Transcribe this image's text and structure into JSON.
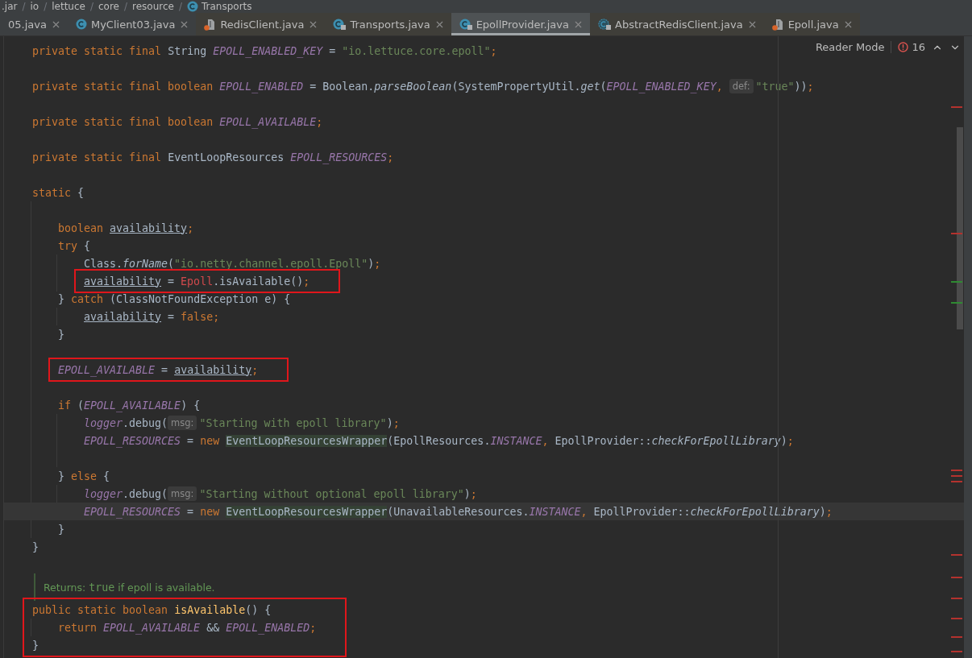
{
  "breadcrumb_separator": "/",
  "breadcrumb": [
    {
      "label": ".jar"
    },
    {
      "label": "io"
    },
    {
      "label": "lettuce"
    },
    {
      "label": "core"
    },
    {
      "label": "resource"
    },
    {
      "label": "Transports",
      "kind": "class"
    }
  ],
  "tabs": [
    {
      "label": "05.java",
      "selected": false
    },
    {
      "label": "MyClient03.java",
      "kind": "class",
      "selected": false
    },
    {
      "label": "RedisClient.java",
      "kind": "library",
      "selected": false
    },
    {
      "label": "Transports.java",
      "kind": "locked-class",
      "selected": false
    },
    {
      "label": "EpollProvider.java",
      "kind": "locked-class",
      "selected": true
    },
    {
      "label": "AbstractRedisClient.java",
      "kind": "abstract",
      "selected": false
    },
    {
      "label": "Epoll.java",
      "kind": "library",
      "selected": false
    }
  ],
  "reader_mode": {
    "label": "Reader Mode",
    "error_count": "16"
  },
  "lines": [
    {
      "kind": "code",
      "boxed": false,
      "tokens": [
        {
          "kind": "kw",
          "text": "private static final "
        },
        {
          "kind": "plain",
          "text": "String "
        },
        {
          "kind": "const",
          "text": "EPOLL_ENABLED_KEY"
        },
        {
          "kind": "plain",
          "text": " = "
        },
        {
          "kind": "str",
          "text": "\"io.lettuce.core.epoll\""
        },
        {
          "kind": "kw",
          "text": ";"
        }
      ]
    },
    {
      "kind": "blank"
    },
    {
      "kind": "code",
      "boxed": false,
      "tokens": [
        {
          "kind": "kw",
          "text": "private static final boolean "
        },
        {
          "kind": "const",
          "text": "EPOLL_ENABLED"
        },
        {
          "kind": "plain",
          "text": " = Boolean."
        },
        {
          "kind": "method",
          "text": "parseBoolean"
        },
        {
          "kind": "plain",
          "text": "(SystemPropertyUtil."
        },
        {
          "kind": "method",
          "text": "get"
        },
        {
          "kind": "plain",
          "text": "("
        },
        {
          "kind": "const",
          "text": "EPOLL_ENABLED_KEY"
        },
        {
          "kind": "kw",
          "text": ", "
        },
        {
          "kind": "hint",
          "text": "def:"
        },
        {
          "kind": "str",
          "text": "\"true\""
        },
        {
          "kind": "plain",
          "text": "))"
        },
        {
          "kind": "kw",
          "text": ";"
        }
      ]
    },
    {
      "kind": "blank"
    },
    {
      "kind": "code",
      "boxed": false,
      "tokens": [
        {
          "kind": "kw",
          "text": "private static final boolean "
        },
        {
          "kind": "const",
          "text": "EPOLL_AVAILABLE"
        },
        {
          "kind": "kw",
          "text": ";"
        }
      ]
    },
    {
      "kind": "blank"
    },
    {
      "kind": "code",
      "boxed": false,
      "tokens": [
        {
          "kind": "kw",
          "text": "private static final "
        },
        {
          "kind": "plain",
          "text": "EventLoopResources "
        },
        {
          "kind": "const",
          "text": "EPOLL_RESOURCES"
        },
        {
          "kind": "kw",
          "text": ";"
        }
      ]
    },
    {
      "kind": "blank"
    },
    {
      "kind": "block",
      "boxed": false,
      "head": [
        {
          "kind": "kw",
          "text": "static "
        },
        {
          "kind": "plain",
          "text": "{"
        }
      ],
      "close": [
        {
          "kind": "plain",
          "text": "}"
        }
      ],
      "children": [
        {
          "kind": "blank"
        },
        {
          "kind": "code",
          "boxed": false,
          "tokens": [
            {
              "kind": "kw",
              "text": "boolean "
            },
            {
              "kind": "var",
              "text": "availability"
            },
            {
              "kind": "kw",
              "text": ";"
            }
          ]
        },
        {
          "kind": "block",
          "boxed": false,
          "head": [
            {
              "kind": "kw",
              "text": "try "
            },
            {
              "kind": "plain",
              "text": "{"
            }
          ],
          "children": [
            {
              "kind": "code",
              "boxed": false,
              "tokens": [
                {
                  "kind": "plain",
                  "text": "Class."
                },
                {
                  "kind": "method",
                  "text": "forName"
                },
                {
                  "kind": "plain",
                  "text": "("
                },
                {
                  "kind": "str",
                  "text": "\"io.netty.channel.epoll.Epoll\""
                },
                {
                  "kind": "plain",
                  "text": ")"
                },
                {
                  "kind": "kw",
                  "text": ";"
                }
              ]
            },
            {
              "kind": "code",
              "boxed": true,
              "tokens": [
                {
                  "kind": "var",
                  "text": "availability"
                },
                {
                  "kind": "plain",
                  "text": " = "
                },
                {
                  "kind": "error",
                  "text": "Epoll"
                },
                {
                  "kind": "plain",
                  "text": ".isAvailable()"
                },
                {
                  "kind": "kw",
                  "text": ";"
                }
              ]
            }
          ]
        },
        {
          "kind": "block",
          "boxed": false,
          "head": [
            {
              "kind": "plain",
              "text": "} "
            },
            {
              "kind": "kw",
              "text": "catch "
            },
            {
              "kind": "plain",
              "text": "(ClassNotFoundException e) {"
            }
          ],
          "close": [
            {
              "kind": "plain",
              "text": "}"
            }
          ],
          "children": [
            {
              "kind": "code",
              "boxed": false,
              "tokens": [
                {
                  "kind": "var",
                  "text": "availability"
                },
                {
                  "kind": "plain",
                  "text": " = "
                },
                {
                  "kind": "kw",
                  "text": "false;"
                }
              ]
            }
          ]
        },
        {
          "kind": "blank"
        },
        {
          "kind": "code",
          "boxed": true,
          "tokens": [
            {
              "kind": "const",
              "text": "EPOLL_AVAILABLE"
            },
            {
              "kind": "plain",
              "text": " = "
            },
            {
              "kind": "var",
              "text": "availability"
            },
            {
              "kind": "kw",
              "text": ";"
            }
          ]
        },
        {
          "kind": "blank"
        },
        {
          "kind": "block",
          "boxed": false,
          "head": [
            {
              "kind": "kw",
              "text": "if "
            },
            {
              "kind": "plain",
              "text": "("
            },
            {
              "kind": "const",
              "text": "EPOLL_AVAILABLE"
            },
            {
              "kind": "plain",
              "text": ") {"
            }
          ],
          "children": [
            {
              "kind": "code",
              "boxed": false,
              "tokens": [
                {
                  "kind": "const",
                  "text": "logger"
                },
                {
                  "kind": "plain",
                  "text": ".debug("
                },
                {
                  "kind": "hint",
                  "text": "msg:"
                },
                {
                  "kind": "str",
                  "text": "\"Starting with epoll library\""
                },
                {
                  "kind": "plain",
                  "text": ")"
                },
                {
                  "kind": "kw",
                  "text": ";"
                }
              ]
            },
            {
              "kind": "code",
              "boxed": false,
              "tokens": [
                {
                  "kind": "const",
                  "text": "EPOLL_RESOURCES"
                },
                {
                  "kind": "plain",
                  "text": " = "
                },
                {
                  "kind": "kw",
                  "text": "new "
                },
                {
                  "kind": "wrapper",
                  "text": "EventLoopResourcesWrapper"
                },
                {
                  "kind": "plain",
                  "text": "(EpollResources."
                },
                {
                  "kind": "const",
                  "text": "INSTANCE"
                },
                {
                  "kind": "kw",
                  "text": ", "
                },
                {
                  "kind": "plain",
                  "text": "EpollProvider::"
                },
                {
                  "kind": "method",
                  "text": "checkForEpollLibrary"
                },
                {
                  "kind": "plain",
                  "text": ")"
                },
                {
                  "kind": "kw",
                  "text": ";"
                }
              ]
            },
            {
              "kind": "blank"
            }
          ]
        },
        {
          "kind": "block",
          "boxed": false,
          "head": [
            {
              "kind": "plain",
              "text": "} "
            },
            {
              "kind": "kw",
              "text": "else "
            },
            {
              "kind": "plain",
              "text": "{"
            }
          ],
          "close": [
            {
              "kind": "plain",
              "text": "}"
            }
          ],
          "children": [
            {
              "kind": "code",
              "boxed": false,
              "tokens": [
                {
                  "kind": "const",
                  "text": "logger"
                },
                {
                  "kind": "plain",
                  "text": ".debug("
                },
                {
                  "kind": "hint",
                  "text": "msg:"
                },
                {
                  "kind": "str",
                  "text": "\"Starting without optional epoll library\""
                },
                {
                  "kind": "plain",
                  "text": ")"
                },
                {
                  "kind": "kw",
                  "text": ";"
                }
              ]
            },
            {
              "kind": "code",
              "current": true,
              "boxed": false,
              "tokens": [
                {
                  "kind": "const",
                  "text": "EPOLL_RESOURCES"
                },
                {
                  "kind": "plain",
                  "text": " = "
                },
                {
                  "kind": "kw",
                  "text": "new "
                },
                {
                  "kind": "wrapper",
                  "text": "EventLoopResourcesWrapper"
                },
                {
                  "kind": "plain",
                  "text": "(UnavailableResources."
                },
                {
                  "kind": "const",
                  "text": "INSTANCE"
                },
                {
                  "kind": "kw",
                  "text": ", "
                },
                {
                  "kind": "plain",
                  "text": "EpollProvider::"
                },
                {
                  "kind": "method",
                  "text": "checkForEpollLibrary"
                },
                {
                  "kind": "plain",
                  "text": ")"
                },
                {
                  "kind": "kw",
                  "text": ";"
                }
              ]
            }
          ]
        }
      ]
    },
    {
      "kind": "blank"
    },
    {
      "kind": "doc",
      "tokens": [
        {
          "kind": "doc",
          "text": "Returns: "
        },
        {
          "kind": "doccode",
          "text": "true"
        },
        {
          "kind": "doc",
          "text": " if epoll is available."
        }
      ]
    },
    {
      "kind": "block",
      "boxed": true,
      "head": [
        {
          "kind": "kw",
          "text": "public static boolean "
        },
        {
          "kind": "decl",
          "text": "isAvailable"
        },
        {
          "kind": "plain",
          "text": "() {"
        }
      ],
      "close": [
        {
          "kind": "plain",
          "text": "}"
        }
      ],
      "children": [
        {
          "kind": "code",
          "boxed": false,
          "tokens": [
            {
              "kind": "kw",
              "text": "return "
            },
            {
              "kind": "const",
              "text": "EPOLL_AVAILABLE"
            },
            {
              "kind": "plain",
              "text": " && "
            },
            {
              "kind": "const",
              "text": "EPOLL_ENABLED"
            },
            {
              "kind": "kw",
              "text": ";"
            }
          ]
        }
      ]
    }
  ]
}
